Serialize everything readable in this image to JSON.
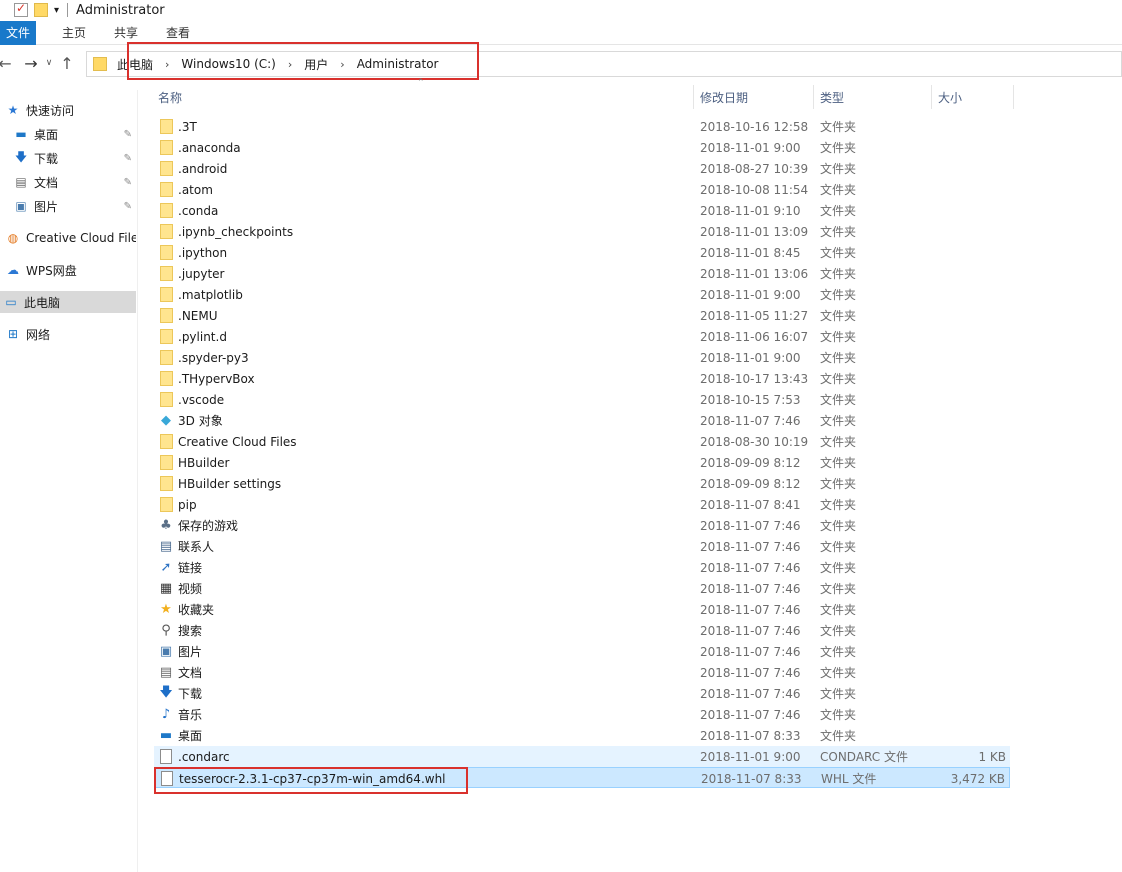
{
  "title_bar": {
    "title": "Administrator",
    "dropdown_arrow": "▾"
  },
  "ribbon": {
    "file_tab": "文件",
    "tabs": [
      "主页",
      "共享",
      "查看"
    ]
  },
  "nav": {
    "back": "←",
    "forward": "→",
    "recent": "∨",
    "up": "↑",
    "crumbs": [
      "此电脑",
      "Windows10 (C:)",
      "用户",
      "Administrator"
    ],
    "crumb_sep": "›"
  },
  "sidebar": {
    "items": [
      {
        "label": "快速访问",
        "icon": "star-icon",
        "glyph": "★",
        "color": "#2b78d4"
      },
      {
        "label": "桌面",
        "icon": "desktop-icon",
        "glyph": "▬",
        "color": "#1e78c8",
        "pinned": true
      },
      {
        "label": "下载",
        "icon": "download-arrow-icon",
        "glyph": "🡇",
        "color": "#1e6fc8",
        "pinned": true
      },
      {
        "label": "文档",
        "icon": "document-icon",
        "glyph": "▤",
        "color": "#666",
        "pinned": true
      },
      {
        "label": "图片",
        "icon": "picture-icon",
        "glyph": "▣",
        "color": "#4a7cae",
        "pinned": true
      },
      {
        "label": "Creative Cloud Files",
        "icon": "creative-cloud-icon",
        "glyph": "◍",
        "color": "#e3761c"
      },
      {
        "label": "WPS网盘",
        "icon": "cloud-icon",
        "glyph": "☁",
        "color": "#2b78d4"
      },
      {
        "label": "此电脑",
        "icon": "computer-icon",
        "glyph": "▭",
        "color": "#1e78c8"
      },
      {
        "label": "网络",
        "icon": "network-icon",
        "glyph": "⊞",
        "color": "#1e78c8"
      }
    ],
    "pin_glyph": "✎"
  },
  "columns": {
    "name": "名称",
    "date": "修改日期",
    "type": "类型",
    "size": "大小",
    "sort_glyph": "⌃"
  },
  "files": [
    {
      "name": ".3T",
      "date": "2018-10-16 12:58",
      "type": "文件夹",
      "size": "",
      "icon": "folder"
    },
    {
      "name": ".anaconda",
      "date": "2018-11-01 9:00",
      "type": "文件夹",
      "size": "",
      "icon": "folder"
    },
    {
      "name": ".android",
      "date": "2018-08-27 10:39",
      "type": "文件夹",
      "size": "",
      "icon": "folder"
    },
    {
      "name": ".atom",
      "date": "2018-10-08 11:54",
      "type": "文件夹",
      "size": "",
      "icon": "folder"
    },
    {
      "name": ".conda",
      "date": "2018-11-01 9:10",
      "type": "文件夹",
      "size": "",
      "icon": "folder"
    },
    {
      "name": ".ipynb_checkpoints",
      "date": "2018-11-01 13:09",
      "type": "文件夹",
      "size": "",
      "icon": "folder"
    },
    {
      "name": ".ipython",
      "date": "2018-11-01 8:45",
      "type": "文件夹",
      "size": "",
      "icon": "folder"
    },
    {
      "name": ".jupyter",
      "date": "2018-11-01 13:06",
      "type": "文件夹",
      "size": "",
      "icon": "folder"
    },
    {
      "name": ".matplotlib",
      "date": "2018-11-01 9:00",
      "type": "文件夹",
      "size": "",
      "icon": "folder"
    },
    {
      "name": ".NEMU",
      "date": "2018-11-05 11:27",
      "type": "文件夹",
      "size": "",
      "icon": "folder"
    },
    {
      "name": ".pylint.d",
      "date": "2018-11-06 16:07",
      "type": "文件夹",
      "size": "",
      "icon": "folder"
    },
    {
      "name": ".spyder-py3",
      "date": "2018-11-01 9:00",
      "type": "文件夹",
      "size": "",
      "icon": "folder"
    },
    {
      "name": ".THypervBox",
      "date": "2018-10-17 13:43",
      "type": "文件夹",
      "size": "",
      "icon": "folder"
    },
    {
      "name": ".vscode",
      "date": "2018-10-15 7:53",
      "type": "文件夹",
      "size": "",
      "icon": "folder"
    },
    {
      "name": "3D 对象",
      "date": "2018-11-07 7:46",
      "type": "文件夹",
      "size": "",
      "icon": "cube"
    },
    {
      "name": "Creative Cloud Files",
      "date": "2018-08-30 10:19",
      "type": "文件夹",
      "size": "",
      "icon": "folder"
    },
    {
      "name": "HBuilder",
      "date": "2018-09-09 8:12",
      "type": "文件夹",
      "size": "",
      "icon": "folder"
    },
    {
      "name": "HBuilder settings",
      "date": "2018-09-09 8:12",
      "type": "文件夹",
      "size": "",
      "icon": "folder"
    },
    {
      "name": "pip",
      "date": "2018-11-07 8:41",
      "type": "文件夹",
      "size": "",
      "icon": "folder"
    },
    {
      "name": "保存的游戏",
      "date": "2018-11-07 7:46",
      "type": "文件夹",
      "size": "",
      "icon": "games"
    },
    {
      "name": "联系人",
      "date": "2018-11-07 7:46",
      "type": "文件夹",
      "size": "",
      "icon": "contacts"
    },
    {
      "name": "链接",
      "date": "2018-11-07 7:46",
      "type": "文件夹",
      "size": "",
      "icon": "links"
    },
    {
      "name": "视频",
      "date": "2018-11-07 7:46",
      "type": "文件夹",
      "size": "",
      "icon": "video"
    },
    {
      "name": "收藏夹",
      "date": "2018-11-07 7:46",
      "type": "文件夹",
      "size": "",
      "icon": "favorites"
    },
    {
      "name": "搜索",
      "date": "2018-11-07 7:46",
      "type": "文件夹",
      "size": "",
      "icon": "search"
    },
    {
      "name": "图片",
      "date": "2018-11-07 7:46",
      "type": "文件夹",
      "size": "",
      "icon": "pictures"
    },
    {
      "name": "文档",
      "date": "2018-11-07 7:46",
      "type": "文件夹",
      "size": "",
      "icon": "documents"
    },
    {
      "name": "下载",
      "date": "2018-11-07 7:46",
      "type": "文件夹",
      "size": "",
      "icon": "downloads"
    },
    {
      "name": "音乐",
      "date": "2018-11-07 7:46",
      "type": "文件夹",
      "size": "",
      "icon": "music"
    },
    {
      "name": "桌面",
      "date": "2018-11-07 8:33",
      "type": "文件夹",
      "size": "",
      "icon": "desktop"
    },
    {
      "name": ".condarc",
      "date": "2018-11-01 9:00",
      "type": "CONDARC 文件",
      "size": "1 KB",
      "icon": "file",
      "state": "hover"
    },
    {
      "name": "tesserocr-2.3.1-cp37-cp37m-win_amd64.whl",
      "date": "2018-11-07 8:33",
      "type": "WHL 文件",
      "size": "3,472 KB",
      "icon": "file",
      "state": "selected"
    }
  ],
  "icon_glyphs": {
    "cube": {
      "glyph": "◆",
      "color": "#39a8d8"
    },
    "games": {
      "glyph": "♣",
      "color": "#5a6f87"
    },
    "contacts": {
      "glyph": "▤",
      "color": "#4b6b8f"
    },
    "links": {
      "glyph": "➚",
      "color": "#2d73c4"
    },
    "video": {
      "glyph": "▦",
      "color": "#333"
    },
    "favorites": {
      "glyph": "★",
      "color": "#f2b01e"
    },
    "search": {
      "glyph": "⚲",
      "color": "#555"
    },
    "pictures": {
      "glyph": "▣",
      "color": "#4a7cae"
    },
    "documents": {
      "glyph": "▤",
      "color": "#666"
    },
    "downloads": {
      "glyph": "🡇",
      "color": "#1e6fc8"
    },
    "music": {
      "glyph": "♪",
      "color": "#1e6fc8"
    },
    "desktop": {
      "glyph": "▬",
      "color": "#1e78c8"
    }
  }
}
